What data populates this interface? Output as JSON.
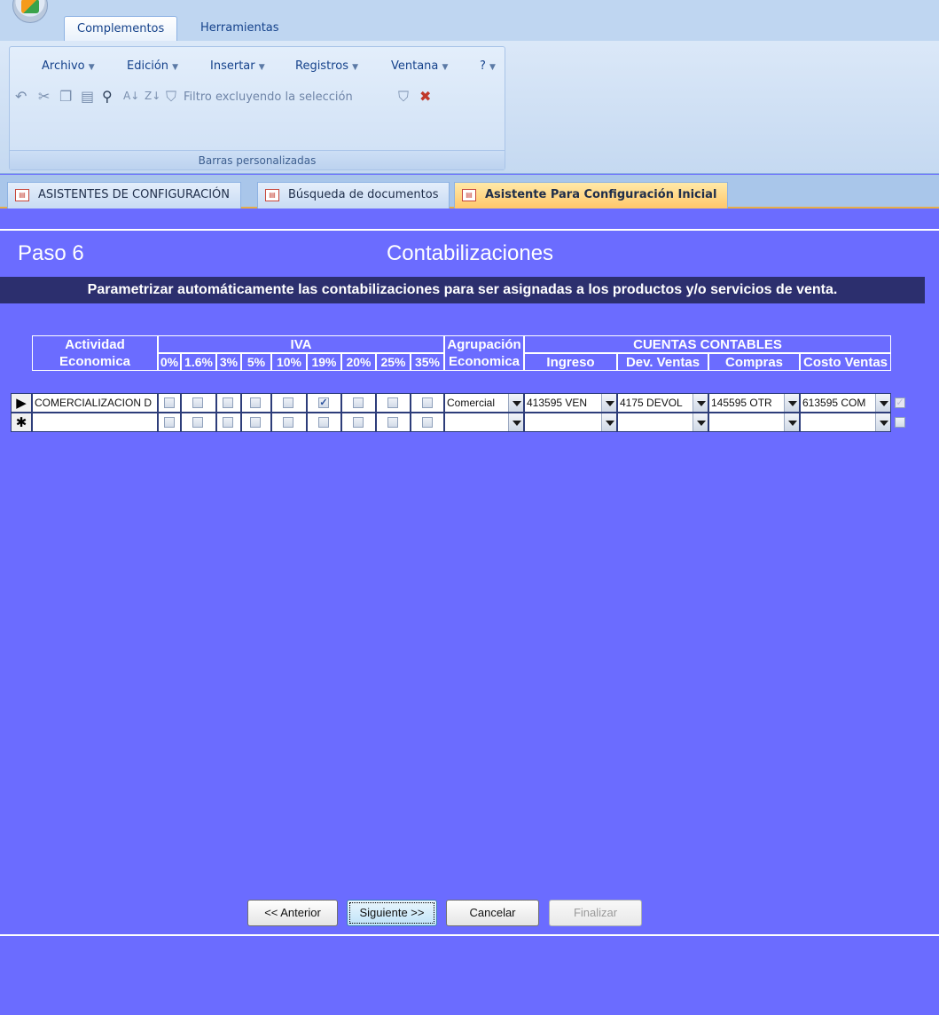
{
  "ribbon": {
    "tabs": [
      {
        "label": "Complementos",
        "active": true
      },
      {
        "label": "Herramientas",
        "active": false
      }
    ],
    "menu": [
      "Archivo",
      "Edición",
      "Insertar",
      "Registros",
      "Ventana",
      "?"
    ],
    "filter_label": "Filtro excluyendo la selección",
    "group_label": "Barras personalizadas"
  },
  "doc_tabs": [
    {
      "label": "ASISTENTES DE CONFIGURACIÓN",
      "active": false
    },
    {
      "label": "Búsqueda de documentos",
      "active": false
    },
    {
      "label": "Asistente Para Configuración Inicial",
      "active": true
    }
  ],
  "form": {
    "step": "Paso 6",
    "title": "Contabilizaciones",
    "subtitle": "Parametrizar automáticamente las contabilizaciones para ser asignadas a los productos y/o servicios de venta."
  },
  "grid": {
    "headers": {
      "actividad_1": "Actividad",
      "actividad_2": "Economica",
      "iva": "IVA",
      "agrupacion_1": "Agrupación",
      "agrupacion_2": "Economica",
      "cuentas": "CUENTAS CONTABLES",
      "iva_rates": [
        "0%",
        "1.6%",
        "3%",
        "5%",
        "10%",
        "19%",
        "20%",
        "25%",
        "35%"
      ],
      "ingreso": "Ingreso",
      "dev_ventas": "Dev. Ventas",
      "compras": "Compras",
      "costo_ventas": "Costo Ventas"
    },
    "rows": [
      {
        "selector": "▶",
        "actividad": "COMERCIALIZACION D",
        "iva_checked": [
          false,
          false,
          false,
          false,
          false,
          true,
          false,
          false,
          false
        ],
        "agrupacion": "Comercial",
        "ingreso": "413595 VEN",
        "dev_ventas": "4175 DEVOL",
        "compras": "145595 OTR",
        "costo_ventas": "613595 COM",
        "active": true
      },
      {
        "selector": "✱",
        "actividad": "",
        "iva_checked": [
          false,
          false,
          false,
          false,
          false,
          false,
          false,
          false,
          false
        ],
        "agrupacion": "",
        "ingreso": "",
        "dev_ventas": "",
        "compras": "",
        "costo_ventas": "",
        "active": false
      }
    ]
  },
  "buttons": {
    "anterior": "<< Anterior",
    "siguiente": "Siguiente >>",
    "cancelar": "Cancelar",
    "finalizar": "Finalizar"
  }
}
